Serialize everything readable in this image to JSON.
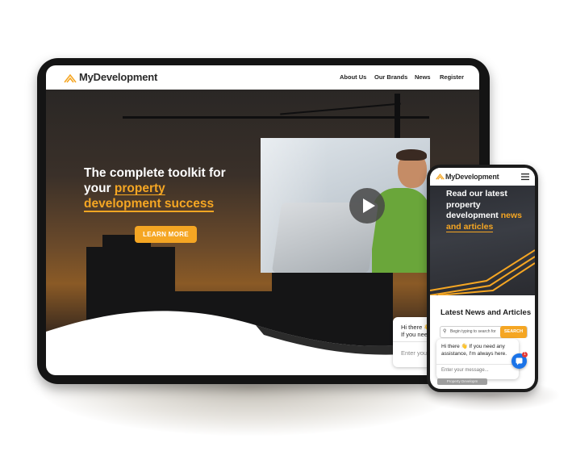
{
  "brand": {
    "name": "MyDevelopment",
    "accent_color": "#f5a623",
    "logo_icon": "roof-icon"
  },
  "tablet": {
    "nav": {
      "links": [
        "About Us",
        "Our Brands",
        "News",
        "Register"
      ]
    },
    "hero": {
      "headline_line1": "The complete toolkit for",
      "headline_word": "your",
      "headline_highlight1": "property",
      "headline_highlight2": "development success",
      "cta_label": "LEARN MORE",
      "video_icon": "play-icon"
    },
    "chat_peek": {
      "message": "Hi there 👋 If you need any assistance",
      "input_placeholder": "Enter you"
    }
  },
  "phone": {
    "hero": {
      "headline_line1": "Read our latest",
      "headline_line2": "property",
      "headline_word": "development",
      "headline_highlight1": "news",
      "headline_highlight2": "and articles"
    },
    "section_title": "Latest News and Articles",
    "search": {
      "placeholder": "Begin typing to search for po",
      "button_label": "SEARCH"
    },
    "chat": {
      "message": "Hi there 👋 If you need any assistance, I'm always here.",
      "input_placeholder": "Enter your message...",
      "badge_count": "1"
    },
    "bottom_button": "Property Developm"
  }
}
